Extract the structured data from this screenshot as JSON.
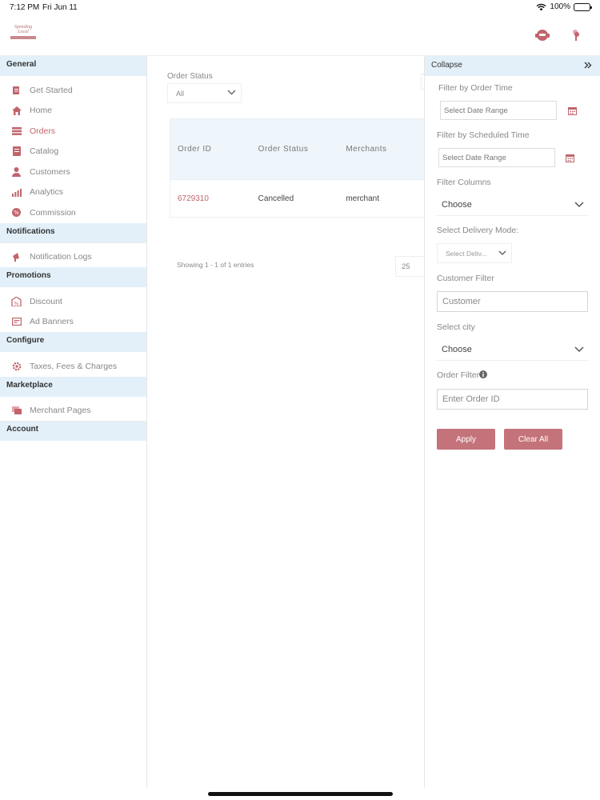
{
  "status_bar": {
    "time": "7:12 PM",
    "date": "Fri Jun 11",
    "battery": "100%"
  },
  "header": {
    "logo_text": "Spending Local",
    "icons": [
      "support-chat-icon",
      "notification-icon"
    ]
  },
  "sidebar": {
    "sections": [
      {
        "title": "General",
        "items": [
          {
            "label": "Get Started",
            "icon": "clipboard-icon"
          },
          {
            "label": "Home",
            "icon": "home-icon"
          },
          {
            "label": "Orders",
            "icon": "orders-icon",
            "active": true
          },
          {
            "label": "Catalog",
            "icon": "catalog-icon"
          },
          {
            "label": "Customers",
            "icon": "customer-icon"
          },
          {
            "label": "Analytics",
            "icon": "analytics-icon"
          },
          {
            "label": "Commission",
            "icon": "commission-icon"
          }
        ]
      },
      {
        "title": "Notifications",
        "items": [
          {
            "label": "Notification Logs",
            "icon": "megaphone-icon"
          }
        ]
      },
      {
        "title": "Promotions",
        "items": [
          {
            "label": "Discount",
            "icon": "discount-icon"
          },
          {
            "label": "Ad Banners",
            "icon": "banner-icon"
          }
        ]
      },
      {
        "title": "Configure",
        "items": [
          {
            "label": "Taxes, Fees & Charges",
            "icon": "gear-icon"
          }
        ]
      },
      {
        "title": "Marketplace",
        "items": [
          {
            "label": "Merchant Pages",
            "icon": "pages-icon"
          }
        ]
      },
      {
        "title": "Account",
        "items": []
      }
    ]
  },
  "main": {
    "order_status_label": "Order Status",
    "order_status_value": "All",
    "table": {
      "columns": [
        "Order ID",
        "Order Status",
        "Merchants"
      ],
      "rows": [
        {
          "order_id": "6729310",
          "status": "Cancelled",
          "merchant": "merchant"
        }
      ]
    },
    "showing_text": "Showing 1 - 1 of 1 entries",
    "page_size": "25"
  },
  "filter_panel": {
    "collapse_label": "Collapse",
    "order_time_label": "Filter by Order Time",
    "order_time_placeholder": "Select Date Range",
    "scheduled_time_label": "Filter by Scheduled Time",
    "scheduled_time_placeholder": "Select Date Range",
    "filter_columns_label": "Filter Columns",
    "filter_columns_value": "Choose",
    "delivery_mode_label": "Select Delivery Mode:",
    "delivery_mode_value": "Select Deliv...",
    "customer_filter_label": "Customer Filter",
    "customer_placeholder": "Customer",
    "city_label": "Select city",
    "city_value": "Choose",
    "order_filter_label": "Order Filter",
    "order_id_placeholder": "Enter Order ID",
    "apply_label": "Apply",
    "clear_label": "Clear All"
  },
  "colors": {
    "accent": "#c0656c",
    "section_bg": "#e3f0f9",
    "button_bg": "#c4737a"
  }
}
